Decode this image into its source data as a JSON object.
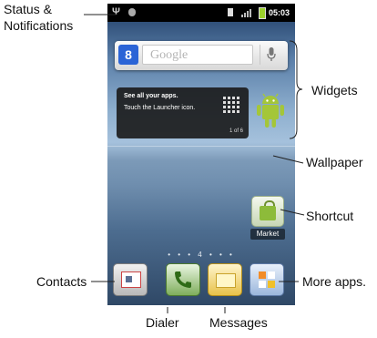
{
  "callouts": {
    "status_line1": "Status &",
    "status_line2": "Notifications",
    "widgets": "Widgets",
    "wallpaper": "Wallpaper",
    "shortcut": "Shortcut",
    "contacts": "Contacts",
    "more_apps": "More apps.",
    "dialer": "Dialer",
    "messages": "Messages"
  },
  "statusbar": {
    "time": "05:03"
  },
  "search_widget": {
    "placeholder": "Google",
    "logo_letter": "8"
  },
  "tip_widget": {
    "line1": "See all your apps.",
    "line2": "Touch the Launcher icon.",
    "page_indicator": "1 of 6"
  },
  "shortcut": {
    "label": "Market"
  },
  "page_dots": "• • • 4 • • •",
  "colors": {
    "status_bar": "#000000",
    "battery": "#9bd12b",
    "android_green": "#a4c639",
    "google_blue": "#2b64d6"
  },
  "icons": [
    "usb-icon",
    "debug-icon",
    "sim-icon",
    "signal-icon",
    "battery-icon",
    "google-logo-icon",
    "mic-icon",
    "launcher-grid-icon",
    "android-robot-icon",
    "market-icon",
    "contacts-icon",
    "dialer-icon",
    "messages-icon",
    "more-apps-icon"
  ]
}
